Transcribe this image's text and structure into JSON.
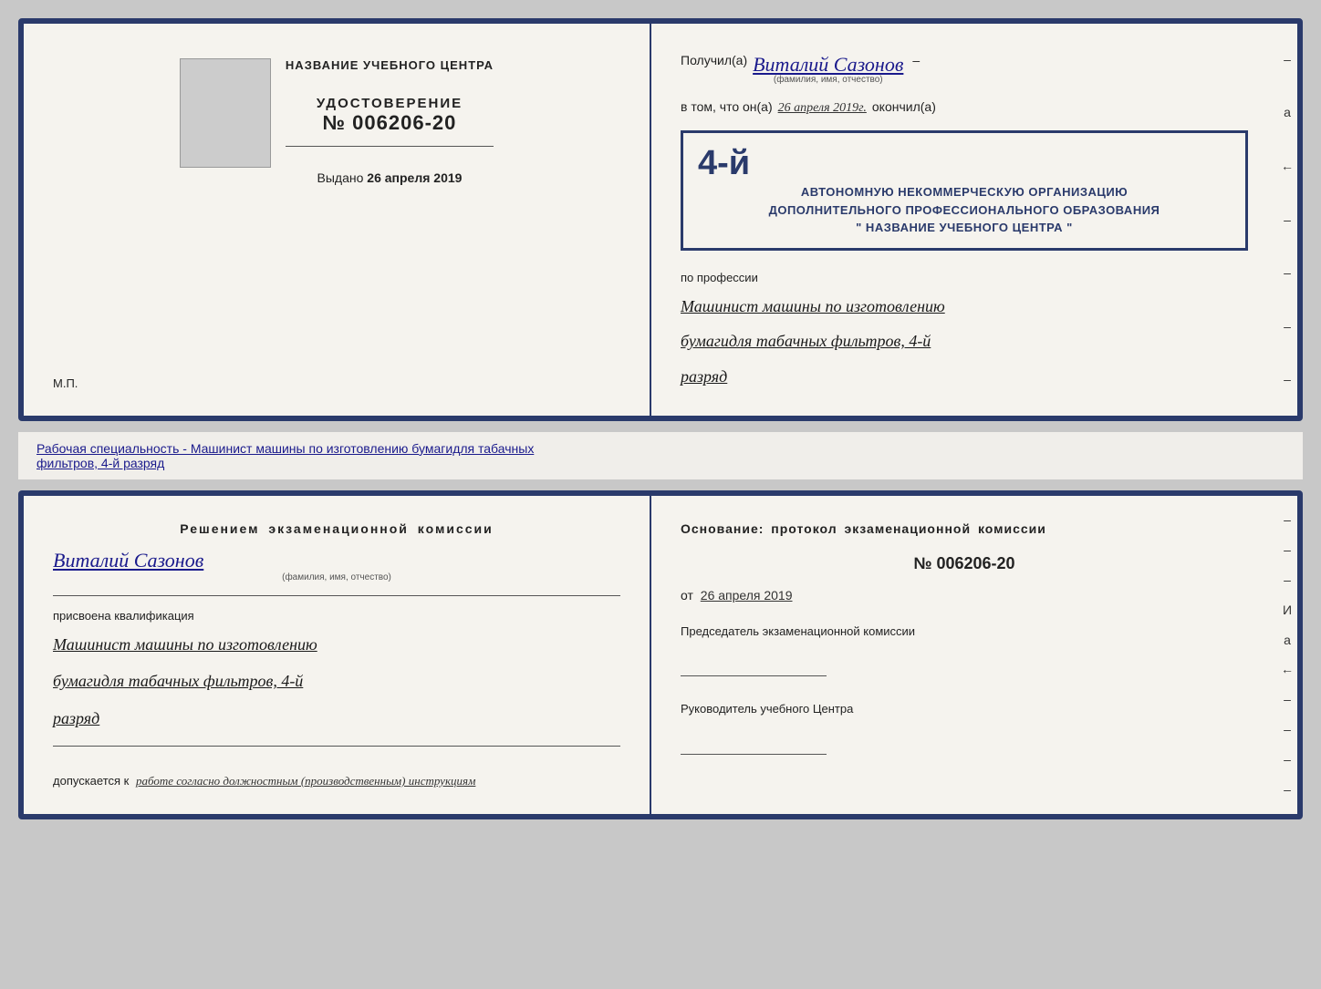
{
  "topDoc": {
    "left": {
      "schoolLabel": "НАЗВАНИЕ УЧЕБНОГО ЦЕНТРА",
      "certLabel": "УДОСТОВЕРЕНИЕ",
      "certNumber": "№ 006206-20",
      "issuedLabel": "Выдано",
      "issuedDate": "26 апреля 2019",
      "mpLabel": "М.П."
    },
    "right": {
      "receivedLabel": "Получил(а)",
      "recipientName": "Виталий Сазонов",
      "recipientSub": "(фамилия, имя, отчество)",
      "dash": "–",
      "vtomLabel": "в том, что он(а)",
      "vtomDate": "26 апреля 2019г.",
      "finishedLabel": "окончил(а)",
      "stampLine1": "4-й",
      "stampLine2": "АВТОНОМНУЮ НЕКОММЕРЧЕСКУЮ ОРГАНИЗАЦИЮ",
      "stampLine3": "ДОПОЛНИТЕЛЬНОГО ПРОФЕССИОНАЛЬНОГО ОБРАЗОВАНИЯ",
      "stampLine4": "\" НАЗВАНИЕ УЧЕБНОГО ЦЕНТРА \"",
      "professionLabel": "по профессии",
      "professionLine1": "Машинист машины по изготовлению",
      "professionLine2": "бумагидля табачных фильтров, 4-й",
      "professionLine3": "разряд"
    },
    "edgeDashes": [
      "–",
      "а",
      "←",
      "–",
      "–",
      "–",
      "–"
    ]
  },
  "betweenDocs": {
    "prefix": "Рабочая специальность - Машинист машины по изготовлению бумагидля табачных",
    "underlined": "фильтров, 4-й разряд"
  },
  "bottomDoc": {
    "left": {
      "resolutionTitle": "Решением  экзаменационной  комиссии",
      "personName": "Виталий Сазонов",
      "personSub": "(фамилия, имя, отчество)",
      "assignedLabel": "присвоена квалификация",
      "qualLine1": "Машинист машины по изготовлению",
      "qualLine2": "бумагидля табачных фильтров, 4-й",
      "qualLine3": "разряд",
      "allowedLabel": "допускается к",
      "allowedCursive": "работе согласно должностным (производственным) инструкциям"
    },
    "right": {
      "basisLabel": "Основание:  протокол  экзаменационной  комиссии",
      "protocolNumber": "№  006206-20",
      "dateLabel": "от",
      "dateValue": "26 апреля 2019",
      "chairmanLabel": "Председатель экзаменационной комиссии",
      "directorLabel": "Руководитель учебного Центра"
    },
    "edgeDashes": [
      "–",
      "–",
      "–",
      "И",
      "а",
      "←",
      "–",
      "–",
      "–",
      "–"
    ]
  }
}
